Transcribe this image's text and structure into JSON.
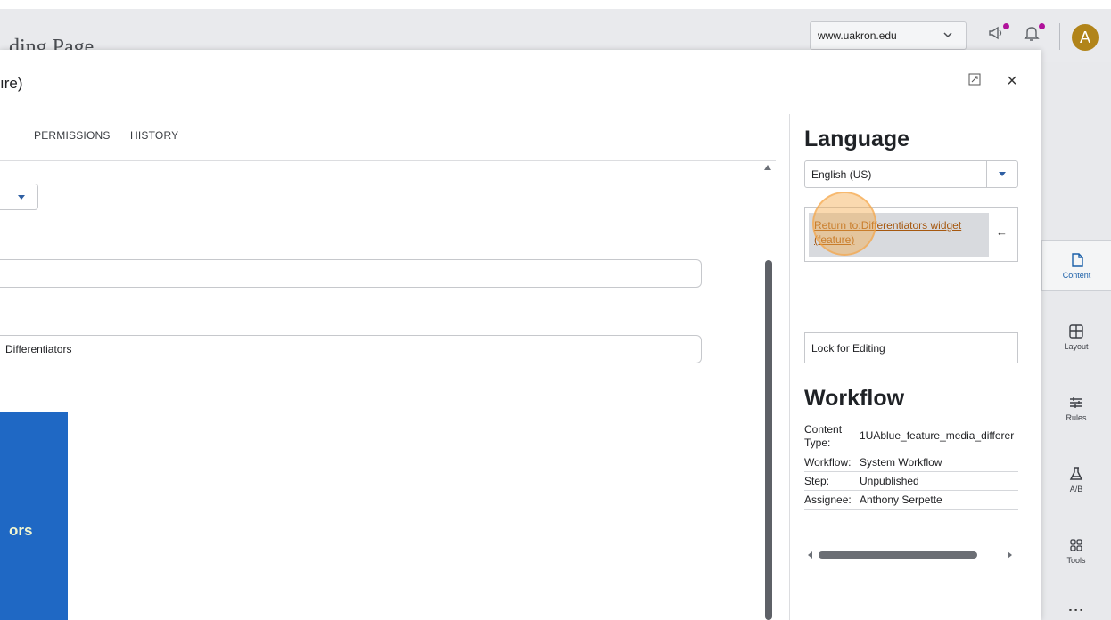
{
  "header": {
    "behind_title": "ding Page",
    "site_select": "www.uakron.edu",
    "avatar_letter": "A"
  },
  "rail": {
    "items": [
      {
        "label": "Content",
        "icon": "file-icon",
        "active": true
      },
      {
        "label": "Layout",
        "icon": "layout-grid-icon"
      },
      {
        "label": "Rules",
        "icon": "sliders-icon"
      },
      {
        "label": "A/B",
        "icon": "flask-icon"
      },
      {
        "label": "Tools",
        "icon": "tools-grid-icon"
      }
    ]
  },
  "modal": {
    "title": "ıre)",
    "tabs": [
      {
        "label": "PERMISSIONS"
      },
      {
        "label": "HISTORY"
      }
    ],
    "fields": {
      "field1_value": "",
      "field2_value": "Differentiators"
    },
    "preview_text": "ors"
  },
  "panel": {
    "language_heading": "Language",
    "language_value": "English (US)",
    "return_link": "Return to:Differentiators widget (feature)",
    "lock_button": "Lock for Editing",
    "workflow_heading": "Workflow",
    "workflow_rows": [
      {
        "key": "Content Type:",
        "value": "1UAblue_feature_media_differer"
      },
      {
        "key": "Workflow:",
        "value": "System Workflow"
      },
      {
        "key": "Step:",
        "value": "Unpublished"
      },
      {
        "key": "Assignee:",
        "value": "Anthony Serpette"
      }
    ]
  },
  "colors": {
    "accent_blue": "#1f68c4",
    "link_orange": "#a6580f",
    "notification_dot": "#b0129b",
    "avatar_bg": "#b1841a"
  }
}
